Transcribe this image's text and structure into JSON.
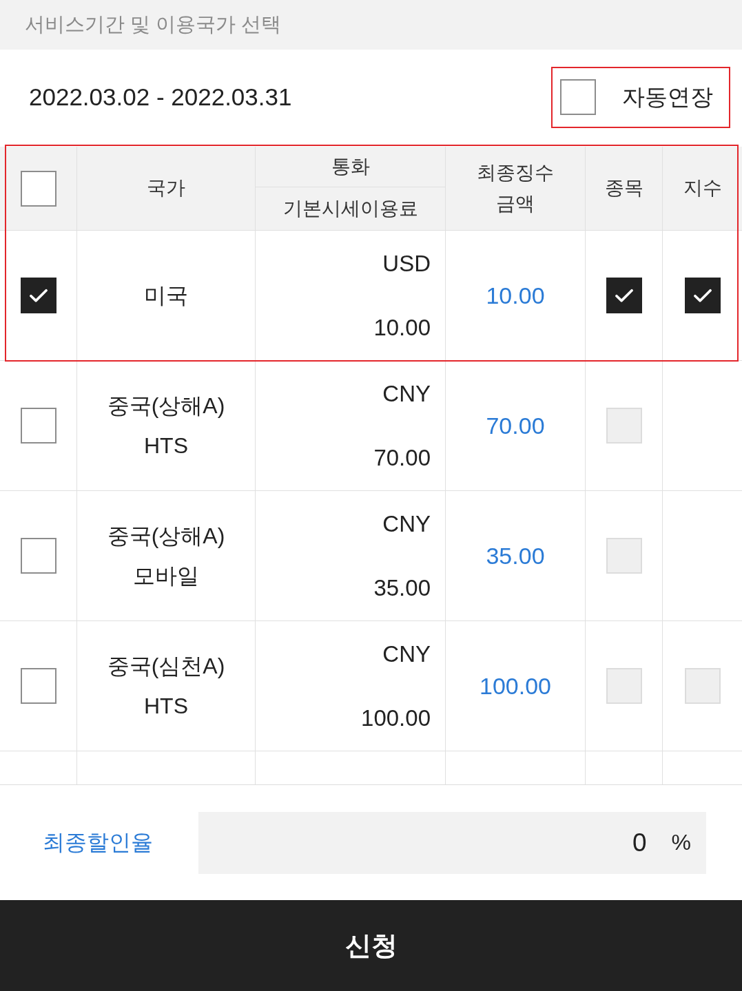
{
  "section_title": "서비스기간 및 이용국가 선택",
  "period": {
    "date_range": "2022.03.02 - 2022.03.31",
    "auto_renew": {
      "label": "자동연장",
      "checked": false,
      "highlighted": true
    }
  },
  "table": {
    "header": {
      "select_all_checked": false,
      "highlighted": true,
      "country": "국가",
      "currency": "통화",
      "base_fee": "기본시세이용료",
      "final_amount": [
        "최종징수",
        "금액"
      ],
      "stock": "종목",
      "index": "지수"
    },
    "rows": [
      {
        "checked": true,
        "highlighted": true,
        "country": [
          "미국"
        ],
        "currency": "USD",
        "base_fee": "10.00",
        "final_amount": "10.00",
        "stock": {
          "checked": true,
          "disabled": false
        },
        "index": {
          "checked": true,
          "disabled": false
        }
      },
      {
        "checked": false,
        "highlighted": false,
        "country": [
          "중국(상해A)",
          "HTS"
        ],
        "currency": "CNY",
        "base_fee": "70.00",
        "final_amount": "70.00",
        "stock": {
          "checked": false,
          "disabled": true
        }
      },
      {
        "checked": false,
        "highlighted": false,
        "country": [
          "중국(상해A)",
          "모바일"
        ],
        "currency": "CNY",
        "base_fee": "35.00",
        "final_amount": "35.00",
        "stock": {
          "checked": false,
          "disabled": true
        }
      },
      {
        "checked": false,
        "highlighted": false,
        "country": [
          "중국(심천A)",
          "HTS"
        ],
        "currency": "CNY",
        "base_fee": "100.00",
        "final_amount": "100.00",
        "stock": {
          "checked": false,
          "disabled": true
        },
        "index": {
          "checked": false,
          "disabled": true
        }
      }
    ]
  },
  "discount": {
    "label": "최종할인율",
    "value": "0",
    "unit": "%"
  },
  "submit": {
    "label": "신청"
  }
}
